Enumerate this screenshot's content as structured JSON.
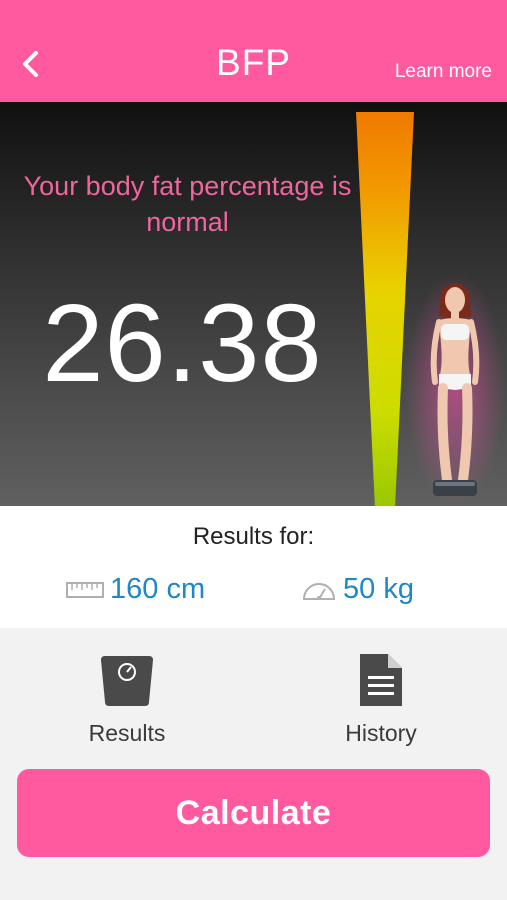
{
  "header": {
    "title": "BFP",
    "learn_more": "Learn more",
    "background": "#ff5aa0"
  },
  "hero": {
    "status_text": "Your body fat percentage is normal",
    "value": "26.38",
    "status_color": "#f0659e"
  },
  "results": {
    "label": "Results for:",
    "height": "160 cm",
    "weight": "50 kg",
    "value_color": "#1f88c4",
    "height_icon": "ruler-icon",
    "weight_icon": "speedometer-icon"
  },
  "tabs": [
    {
      "label": "Results",
      "icon": "scale-icon"
    },
    {
      "label": "History",
      "icon": "document-icon"
    }
  ],
  "calculate_label": "Calculate"
}
